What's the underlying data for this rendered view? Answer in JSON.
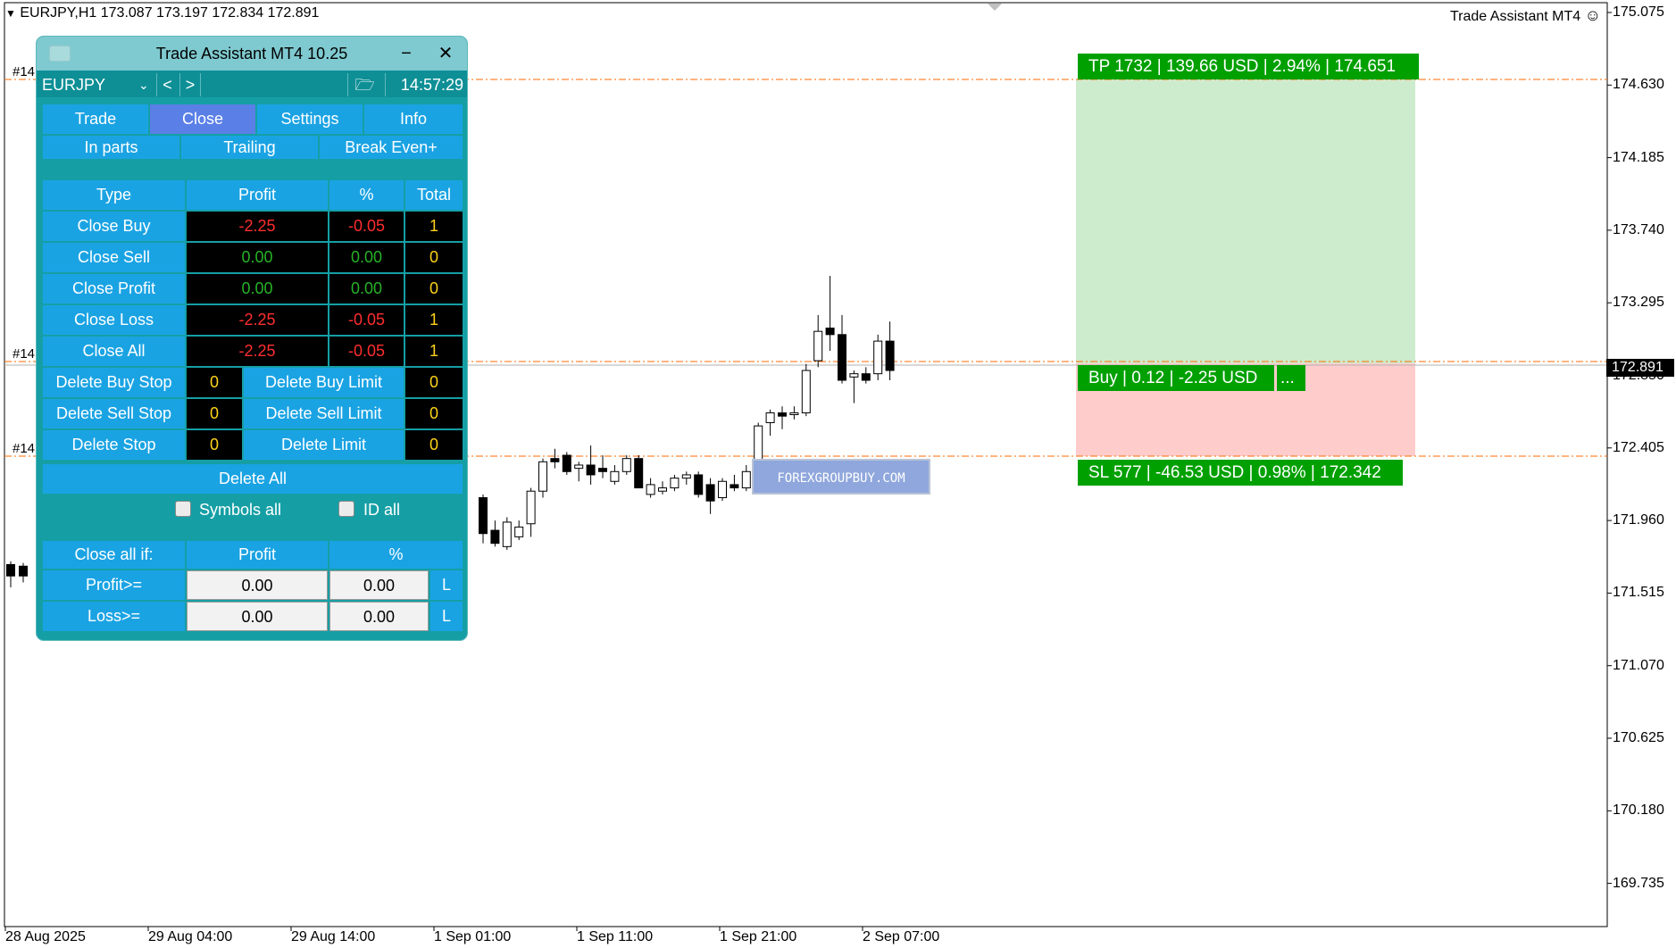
{
  "header": {
    "symbol_info": "EURJPY,H1  173.087 173.197 172.834 172.891",
    "indicator_name": "Trade Assistant MT4"
  },
  "price_axis": {
    "labels": [
      "175.075",
      "174.630",
      "174.185",
      "173.740",
      "173.295",
      "172.850",
      "172.405",
      "171.960",
      "171.515",
      "171.070",
      "170.625",
      "170.180",
      "169.735"
    ],
    "current_price": "172.891"
  },
  "time_axis": {
    "labels": [
      "28 Aug 2025",
      "29 Aug 04:00",
      "29 Aug 14:00",
      "1 Sep 01:00",
      "1 Sep 11:00",
      "1 Sep 21:00",
      "2 Sep 07:00"
    ]
  },
  "order_markers": [
    "#14",
    "#14",
    "#14"
  ],
  "levels": {
    "tp_label": "TP 1732 | 139.66 USD | 2.94% | 174.651",
    "entry_label": "Buy | 0.12 | -2.25 USD",
    "entry_more": "...",
    "sl_label": "SL 577 | -46.53 USD | 0.98% | 172.342",
    "colors": {
      "tp_zone": "#cdeccd",
      "sl_zone": "#ffcccc",
      "tag": "#00a000"
    }
  },
  "watermark": "FOREXGROUPBUY.COM",
  "panel": {
    "title": "Trade Assistant MT4 10.25",
    "symbol": "EURJPY",
    "prev_label": "<",
    "next_label": ">",
    "time": "14:57:29",
    "tabs": [
      "Trade",
      "Close",
      "Settings",
      "Info"
    ],
    "active_tab": "Close",
    "subtabs": [
      "In parts",
      "Trailing",
      "Break Even+"
    ],
    "table_headers": [
      "Type",
      "Profit",
      "%",
      "Total"
    ],
    "rows": [
      {
        "label": "Close Buy",
        "profit": "-2.25",
        "pct": "-0.05",
        "total": "1",
        "sign": "red"
      },
      {
        "label": "Close Sell",
        "profit": "0.00",
        "pct": "0.00",
        "total": "0",
        "sign": "green"
      },
      {
        "label": "Close Profit",
        "profit": "0.00",
        "pct": "0.00",
        "total": "0",
        "sign": "green"
      },
      {
        "label": "Close Loss",
        "profit": "-2.25",
        "pct": "-0.05",
        "total": "1",
        "sign": "red"
      },
      {
        "label": "Close All",
        "profit": "-2.25",
        "pct": "-0.05",
        "total": "1",
        "sign": "red"
      }
    ],
    "delete_rows": [
      {
        "left_label": "Delete Buy Stop",
        "left_count": "0",
        "right_label": "Delete Buy Limit",
        "right_count": "0"
      },
      {
        "left_label": "Delete Sell Stop",
        "left_count": "0",
        "right_label": "Delete Sell Limit",
        "right_count": "0"
      },
      {
        "left_label": "Delete Stop",
        "left_count": "0",
        "right_label": "Delete Limit",
        "right_count": "0"
      }
    ],
    "delete_all": "Delete All",
    "symbols_all": "Symbols all",
    "id_all": "ID all",
    "cond_headers": [
      "Close all if:",
      "Profit",
      "%"
    ],
    "conditions": [
      {
        "label": "Profit>=",
        "profit": "0.00",
        "pct": "0.00",
        "mode": "L"
      },
      {
        "label": "Loss>=",
        "profit": "0.00",
        "pct": "0.00",
        "mode": "L"
      }
    ]
  }
}
